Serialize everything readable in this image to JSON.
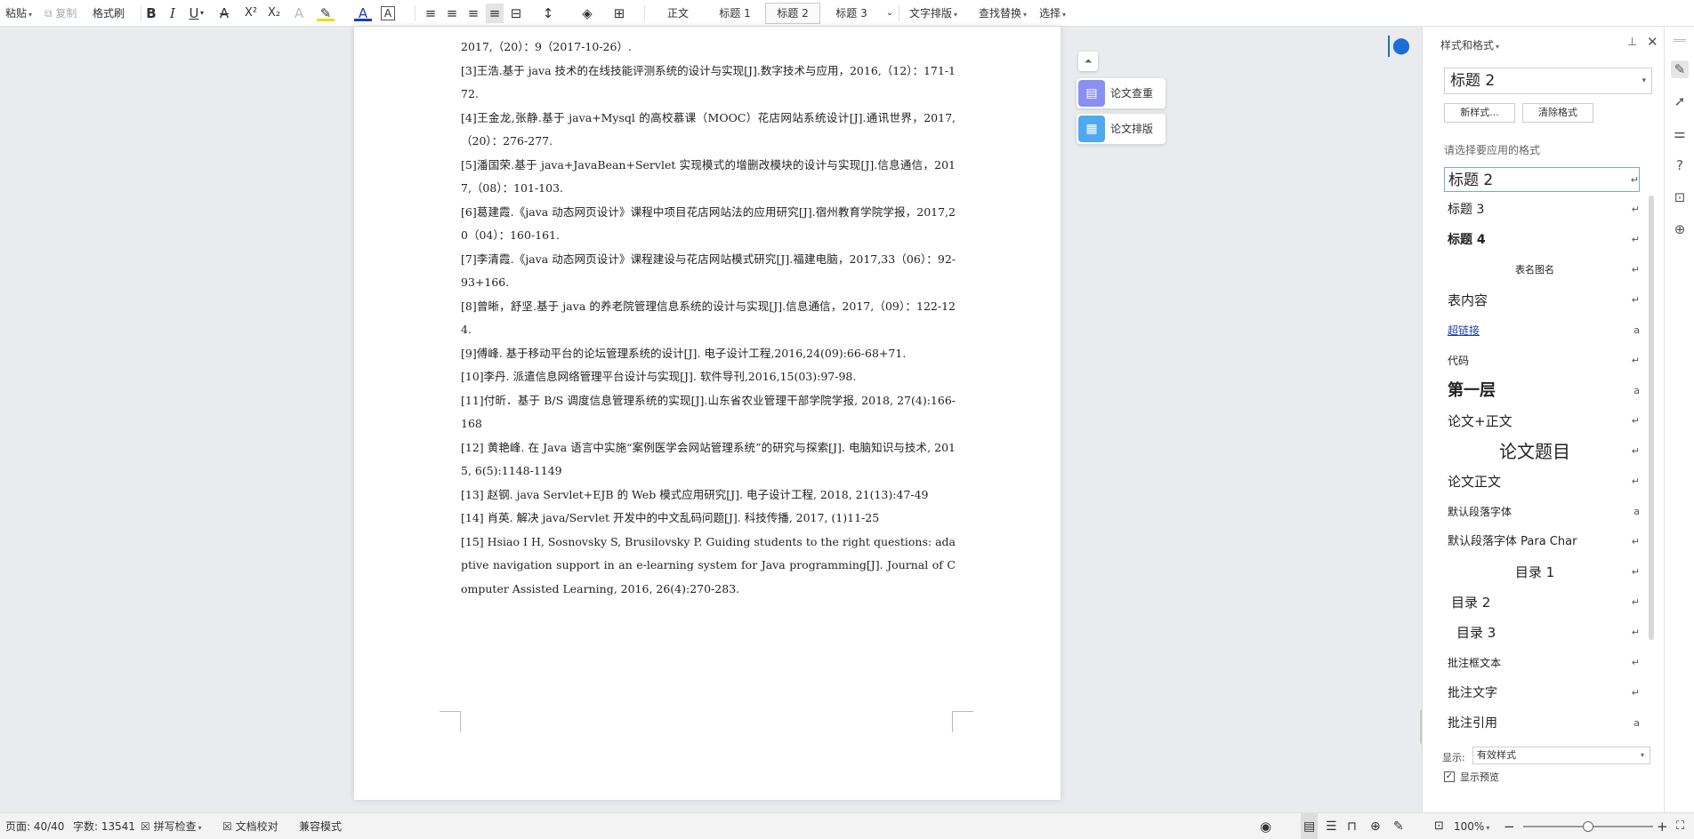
{
  "toolbar": {
    "paste": "粘贴",
    "copy": "复制",
    "format_painter": "格式刷",
    "styles": [
      "正文",
      "标题 1",
      "标题 2",
      "标题 3"
    ],
    "text_layout": "文字排版",
    "find_replace": "查找替换",
    "select": "选择"
  },
  "document": {
    "references": [
      "2017,（20）：9（2017-10-26）.",
      "[3]王浩.基于 java 技术的在线技能评测系统的设计与实现[J].数字技术与应用，2016,（12）：171-172.",
      "[4]王金龙,张静.基于 java+Mysql 的高校慕课（MOOC）花店网站系统设计[J].通讯世界，2017,（20）：276-277.",
      "[5]潘国荣.基于 java+JavaBean+Servlet 实现模式的增删改模块的设计与实现[J].信息通信，2017,（08）：101-103.",
      "[6]葛建霞.《java 动态网页设计》课程中项目花店网站法的应用研究[J].宿州教育学院学报，2017,20（04）：160-161.",
      "[7]李清霞.《java 动态网页设计》课程建设与花店网站模式研究[J].福建电脑，2017,33（06）：92-93+166.",
      "[8]曾晰，舒坚.基于 java 的养老院管理信息系统的设计与实现[J].信息通信，2017,（09）：122-124.",
      "[9]傅峰. 基于移动平台的论坛管理系统的设计[J]. 电子设计工程,2016,24(09):66-68+71.",
      "[10]李丹. 派遣信息网络管理平台设计与实现[J]. 软件导刊,2016,15(03):97-98.",
      "[11]付昕．基于 B/S 调度信息管理系统的实现[J].山东省农业管理干部学院学报, 2018, 27(4):166-168",
      "[12] 黄艳峰. 在 Java 语言中实施“案例医学会网站管理系统”的研究与探索[J]. 电脑知识与技术, 2015, 6(5):1148-1149",
      "[13] 赵钢. java Servlet+EJB 的 Web 模式应用研究[J]. 电子设计工程, 2018, 21(13):47-49",
      "[14] 肖英. 解决 java/Servlet 开发中的中文乱码问题[J]. 科技传播, 2017, (1)11-25",
      "[15] Hsiao I H, Sosnovsky S, Brusilovsky P. Guiding students to the right questions: adaptive navigation support in an e-learning system for Java programming[J]. Journal of Computer Assisted Learning, 2016, 26(4):270-283."
    ]
  },
  "float_buttons": {
    "check": "论文查重",
    "layout": "论文排版"
  },
  "panel": {
    "title": "样式和格式",
    "current_style": "标题 2",
    "new_style": "新样式...",
    "clear_format": "清除格式",
    "prompt": "请选择要应用的格式",
    "styles": [
      {
        "label": "标题 2",
        "mark": "↵"
      },
      {
        "label": "标题 3",
        "mark": "↵"
      },
      {
        "label": "标题 4",
        "mark": "↵"
      },
      {
        "label": "表名图名",
        "mark": "↵"
      },
      {
        "label": "表内容",
        "mark": "↵"
      },
      {
        "label": "超链接",
        "mark": "a"
      },
      {
        "label": "代码",
        "mark": "↵"
      },
      {
        "label": "第一层",
        "mark": "a"
      },
      {
        "label": "论文+正文",
        "mark": "↵"
      },
      {
        "label": "论文题目",
        "mark": "↵"
      },
      {
        "label": "论文正文",
        "mark": "↵"
      },
      {
        "label": "默认段落字体",
        "mark": "a"
      },
      {
        "label": "默认段落字体  Para Char",
        "mark": "↵"
      },
      {
        "label": "目录 1",
        "mark": "↵"
      },
      {
        "label": "目录 2",
        "mark": "↵"
      },
      {
        "label": "目录 3",
        "mark": "↵"
      },
      {
        "label": "批注框文本",
        "mark": "↵"
      },
      {
        "label": "批注文字",
        "mark": "↵"
      },
      {
        "label": "批注引用",
        "mark": "a"
      }
    ],
    "show_label": "显示:",
    "show_value": "有效样式",
    "preview_label": "显示预览"
  },
  "status": {
    "page": "页面: 40/40",
    "words": "字数: 13541",
    "spell": "拼写检查",
    "proof": "文档校对",
    "compat": "兼容模式",
    "zoom": "100%",
    "zoom_level": 0.5
  }
}
